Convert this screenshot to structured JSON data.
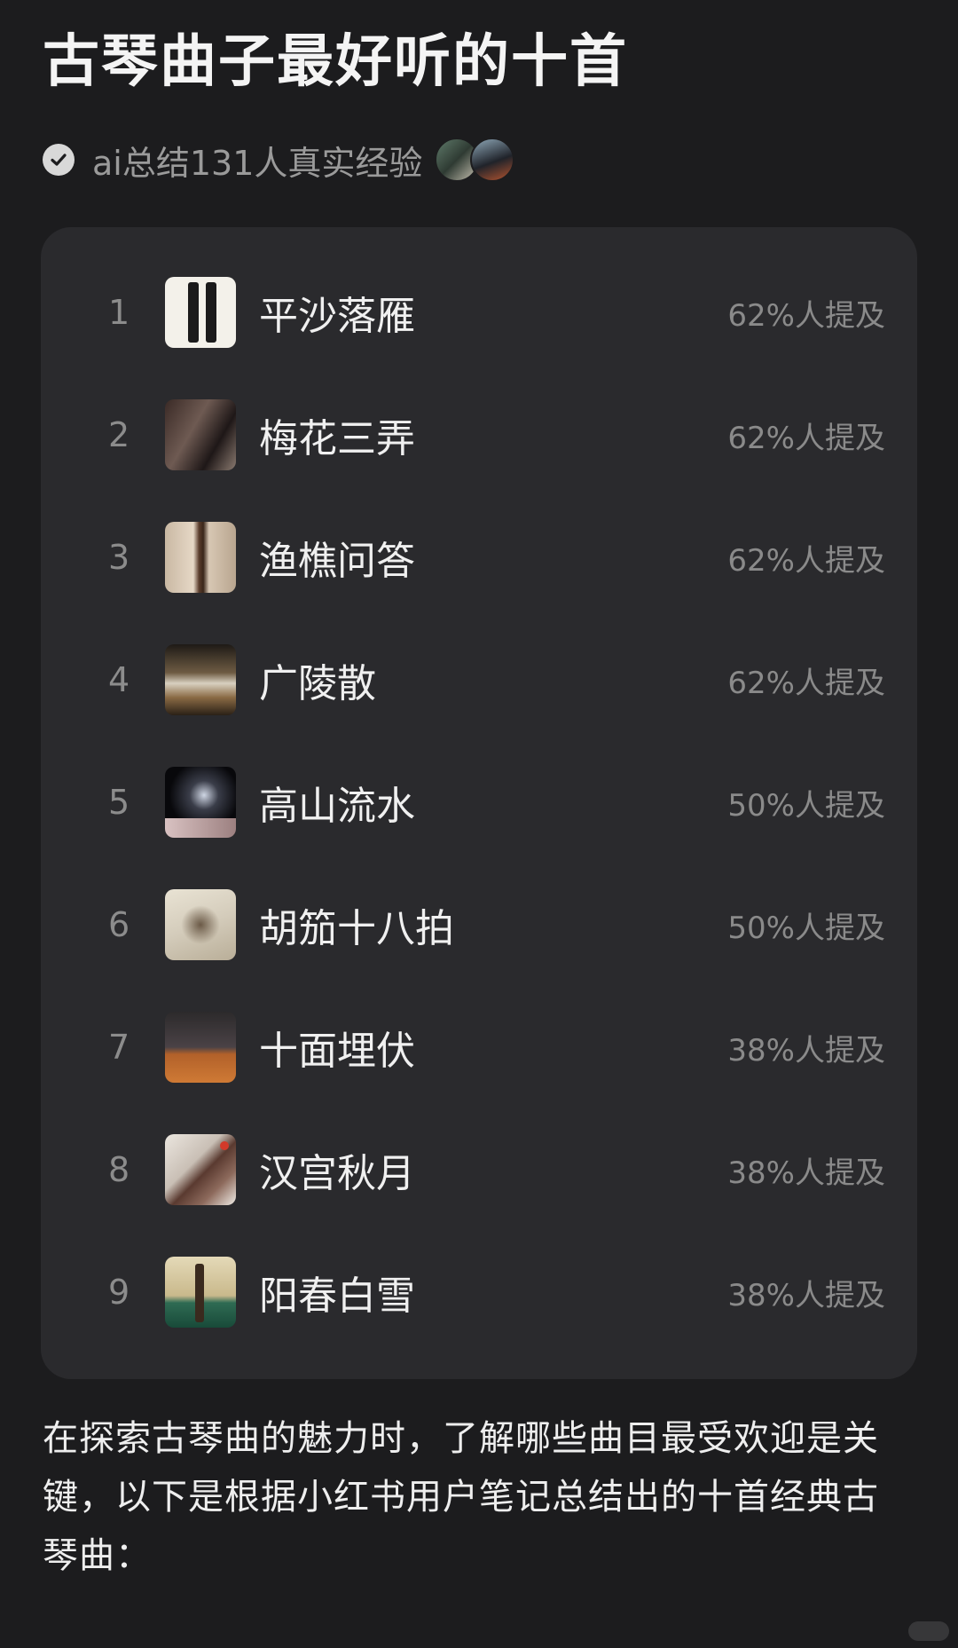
{
  "header": {
    "title": "古琴曲子最好听的十首",
    "meta_text": "ai总结131人真实经验",
    "check_icon": "check-circle-icon"
  },
  "ranking": {
    "items": [
      {
        "rank": "1",
        "title": "平沙落雁",
        "mention": "62%人提及"
      },
      {
        "rank": "2",
        "title": "梅花三弄",
        "mention": "62%人提及"
      },
      {
        "rank": "3",
        "title": "渔樵问答",
        "mention": "62%人提及"
      },
      {
        "rank": "4",
        "title": "广陵散",
        "mention": "62%人提及"
      },
      {
        "rank": "5",
        "title": "高山流水",
        "mention": "50%人提及"
      },
      {
        "rank": "6",
        "title": "胡笳十八拍",
        "mention": "50%人提及"
      },
      {
        "rank": "7",
        "title": "十面埋伏",
        "mention": "38%人提及"
      },
      {
        "rank": "8",
        "title": "汉宫秋月",
        "mention": "38%人提及"
      },
      {
        "rank": "9",
        "title": "阳春白雪",
        "mention": "38%人提及"
      }
    ]
  },
  "body": {
    "paragraph": "在探索古琴曲的魅力时，了解哪些曲目最受欢迎是关键，以下是根据小红书用户笔记总结出的十首经典古琴曲："
  },
  "colors": {
    "background": "#1c1c1e",
    "card": "#2a2a2d",
    "text_primary": "#f0f0f0",
    "text_secondary": "#8a8a8a"
  }
}
